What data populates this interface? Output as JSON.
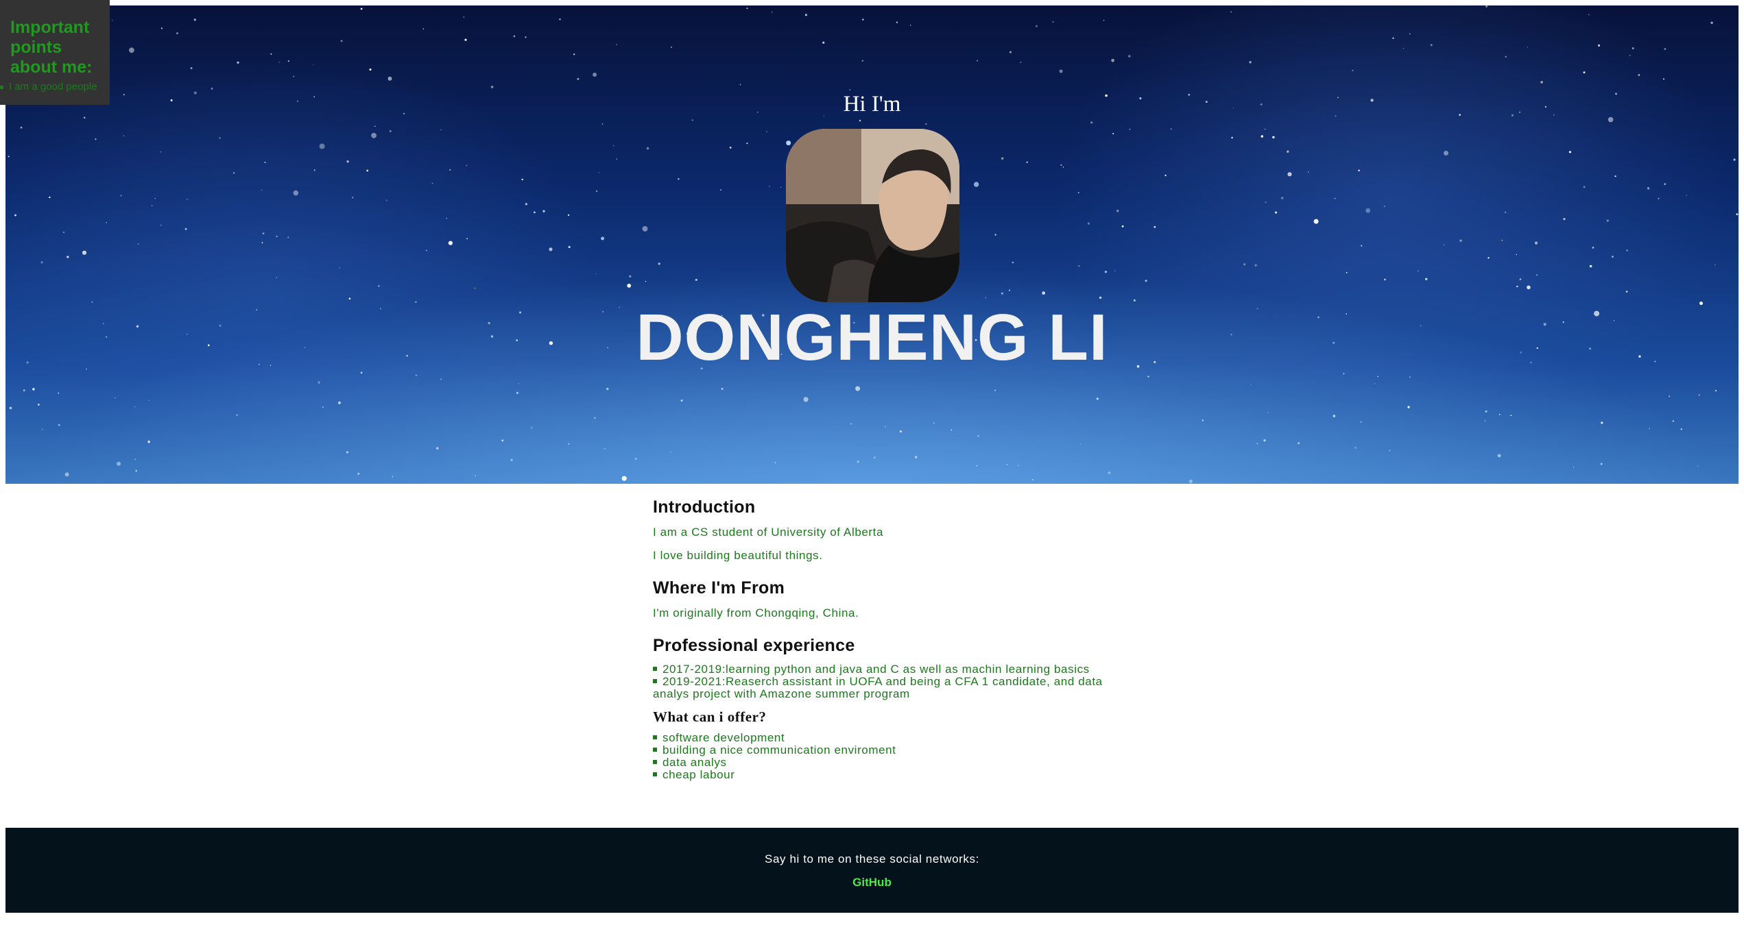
{
  "sidebar": {
    "title": "Important points about me:",
    "items": [
      "I am a good people"
    ]
  },
  "hero": {
    "greeting": "Hi I'm",
    "name": "DONGHENG LI"
  },
  "introduction": {
    "heading": "Introduction",
    "lines": [
      "I am a CS student of University of Alberta",
      "I love building beautiful things."
    ]
  },
  "origin": {
    "heading": "Where I'm From",
    "text": "I'm originally from Chongqing, China."
  },
  "experience": {
    "heading": "Professional experience",
    "items": [
      "2017-2019:learning python and java and C as well as machin learning basics",
      "2019-2021:Reaserch assistant in UOFA and being a CFA 1 candidate, and data analys project with Amazone summer program"
    ]
  },
  "offer": {
    "heading": "What can i offer?",
    "items": [
      "software development",
      "building a nice communication enviroment",
      "data analys",
      "cheap labour"
    ]
  },
  "footer": {
    "text": "Say hi to me on these social networks:",
    "link_label": "GitHub"
  },
  "colors": {
    "accent_green": "#1b7a1b",
    "link_green": "#4dea4d",
    "footer_bg": "#04121c",
    "sidebar_bg": "#333333"
  }
}
